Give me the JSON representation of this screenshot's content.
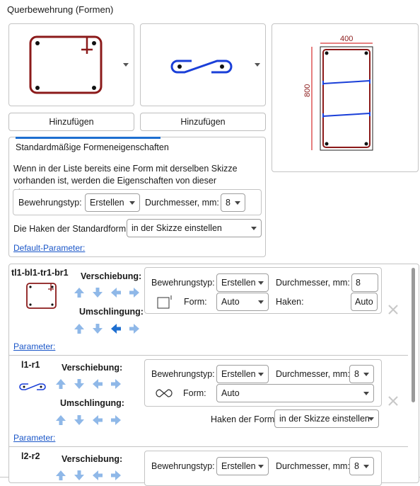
{
  "title": "Querbewehrung (Formen)",
  "buttons": {
    "add_left": "Hinzufügen",
    "add_right": "Hinzufügen"
  },
  "preview": {
    "width_label": "400",
    "height_label": "800"
  },
  "defaults": {
    "tab": "Standardmäßige Formeneigenschaften",
    "description": "Wenn in der Liste bereits eine Form mit derselben Skizze vorhanden ist, werden die Eigenschaften von dieser übernommen",
    "rebar_type_label": "Bewehrungstyp:",
    "rebar_type_value": "Erstellen",
    "diameter_label": "Durchmesser, mm:",
    "diameter_value": "8",
    "hooks_label": "Die Haken der Standardform:",
    "hooks_value": "in der Skizze einstellen",
    "params_link": "Default-Parameter:"
  },
  "shapes": [
    {
      "name": "tl1-bl1-tr1-br1",
      "shift_label": "Verschiebung:",
      "wrap_label": "Umschlingung:",
      "rebar_type_label": "Bewehrungstyp:",
      "rebar_type_value": "Erstellen",
      "diameter_label": "Durchmesser, mm:",
      "diameter_value": "8",
      "form_label": "Form:",
      "form_value": "Auto",
      "hooks_label": "Haken:",
      "hooks_value": "Auto",
      "params_link": "Parameter:"
    },
    {
      "name": "l1-r1",
      "shift_label": "Verschiebung:",
      "wrap_label": "Umschlingung:",
      "rebar_type_label": "Bewehrungstyp:",
      "rebar_type_value": "Erstellen",
      "diameter_label": "Durchmesser, mm:",
      "diameter_value": "8",
      "form_label": "Form:",
      "form_value": "Auto",
      "hooks_label": "Haken der Form:",
      "hooks_value": "in der Skizze einstellen",
      "params_link": "Parameter:"
    },
    {
      "name": "l2-r2",
      "shift_label": "Verschiebung:",
      "rebar_type_label": "Bewehrungstyp:",
      "rebar_type_value": "Erstellen",
      "diameter_label": "Durchmesser, mm:",
      "diameter_value": "8"
    }
  ],
  "colors": {
    "rebar": "#8b1a1a",
    "stirrup": "#1a3fd8",
    "arrow": "#8fb8e8",
    "arrow_active": "#1e6fd0",
    "link": "#1a56c8"
  }
}
